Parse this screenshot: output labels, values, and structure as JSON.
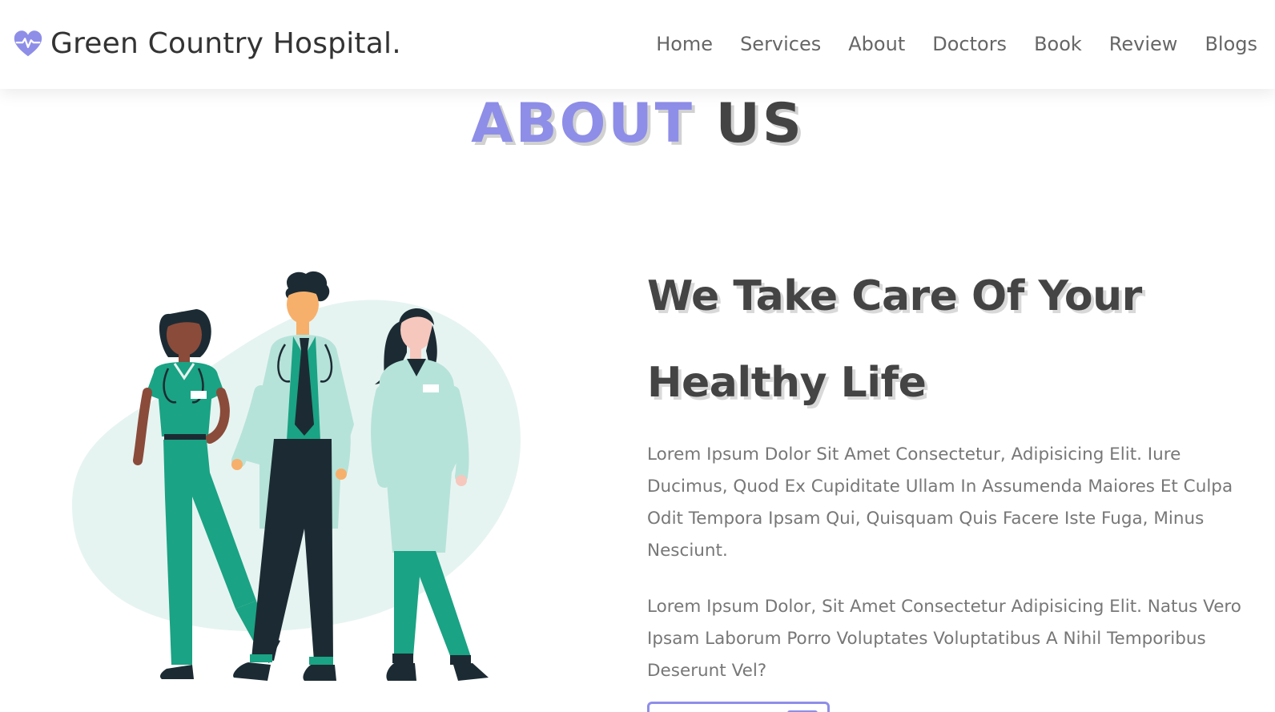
{
  "brand": {
    "name": "Green Country Hospital.",
    "icon": "heartbeat-icon",
    "accent_color": "#8e8ee8"
  },
  "nav": {
    "items": [
      {
        "label": "Home"
      },
      {
        "label": "Services"
      },
      {
        "label": "About"
      },
      {
        "label": "Doctors"
      },
      {
        "label": "Book"
      },
      {
        "label": "Review"
      },
      {
        "label": "Blogs"
      }
    ]
  },
  "section": {
    "heading_accent": "ABOUT",
    "heading_rest": "US"
  },
  "about": {
    "title_line1": "We Take Care Of Your",
    "title_line2": "Healthy Life",
    "paragraph1": "Lorem Ipsum Dolor Sit Amet Consectetur, Adipisicing Elit. Iure Ducimus, Quod Ex Cupiditate Ullam In Assumenda Maiores Et Culpa Odit Tempora Ipsam Qui, Quisquam Quis Facere Iste Fuga, Minus Nesciunt.",
    "paragraph2": "Lorem Ipsum Dolor, Sit Amet Consectetur Adipisicing Elit. Natus Vero Ipsam Laborum Porro Voluptates Voluptatibus A Nihil Temporibus Deserunt Vel?",
    "illustration": "medical-staff-illustration",
    "button_icon": "chevron-right-icon"
  }
}
